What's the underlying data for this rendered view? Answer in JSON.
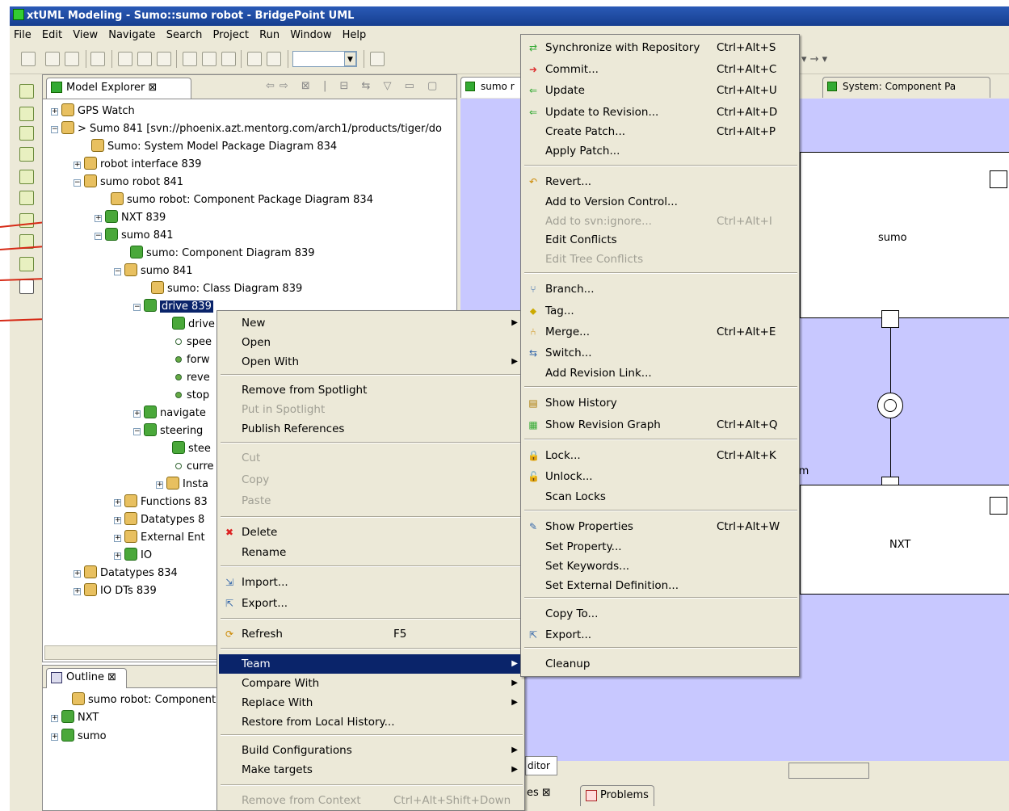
{
  "window": {
    "title": "xtUML Modeling - Sumo::sumo robot - BridgePoint UML"
  },
  "menubar": [
    "File",
    "Edit",
    "View",
    "Navigate",
    "Search",
    "Project",
    "Run",
    "Window",
    "Help"
  ],
  "explorer": {
    "tab_label": "Model Explorer",
    "close_glyph": "⊠",
    "tree": [
      {
        "label": "GPS Watch"
      },
      {
        "label": "> Sumo 841 [svn://phoenix.azt.mentorg.com/arch1/products/tiger/do"
      },
      {
        "label": "Sumo: System Model Package Diagram 834"
      },
      {
        "label": "robot interface 839"
      },
      {
        "label": "sumo robot 841"
      },
      {
        "label": "sumo robot: Component Package Diagram 834"
      },
      {
        "label": "NXT 839"
      },
      {
        "label": "sumo 841"
      },
      {
        "label": "sumo: Component Diagram 839"
      },
      {
        "label": "sumo 841"
      },
      {
        "label": "sumo: Class Diagram 839"
      },
      {
        "label": "drive 839"
      },
      {
        "label": "drive"
      },
      {
        "label": "spee"
      },
      {
        "label": "forw"
      },
      {
        "label": "reve"
      },
      {
        "label": "stop"
      },
      {
        "label": "navigate"
      },
      {
        "label": "steering"
      },
      {
        "label": "stee"
      },
      {
        "label": "curre"
      },
      {
        "label": "Insta"
      },
      {
        "label": "Functions 83"
      },
      {
        "label": "Datatypes 8"
      },
      {
        "label": "External Ent"
      },
      {
        "label": "IO"
      },
      {
        "label": "Datatypes 834"
      },
      {
        "label": "IO DTs 839"
      }
    ]
  },
  "outline": {
    "tab_label": "Outline",
    "items": [
      {
        "label": "sumo robot: Component"
      },
      {
        "label": "NXT"
      },
      {
        "label": "sumo"
      }
    ]
  },
  "editor": {
    "tabs": [
      {
        "label": "sumo r"
      },
      {
        "label": "System: Component Pa"
      }
    ],
    "components": {
      "sumo": "sumo",
      "platform": "platform",
      "nxt": "NXT"
    },
    "bottom_tabs": [
      {
        "label": "es"
      },
      {
        "label": "Problems"
      }
    ],
    "editor_tab_label": "ditor"
  },
  "context_menu": {
    "items": [
      {
        "label": "New",
        "submenu": true
      },
      {
        "label": "Open"
      },
      {
        "label": "Open With",
        "submenu": true
      },
      {
        "label": "Remove from Spotlight"
      },
      {
        "label": "Put in Spotlight",
        "disabled": true
      },
      {
        "label": "Publish References"
      },
      {
        "label": "Cut",
        "disabled": true
      },
      {
        "label": "Copy",
        "disabled": true
      },
      {
        "label": "Paste",
        "disabled": true
      },
      {
        "label": "Delete",
        "icon": "delete-icon"
      },
      {
        "label": "Rename"
      },
      {
        "label": "Import...",
        "icon": "import-icon"
      },
      {
        "label": "Export...",
        "icon": "export-icon"
      },
      {
        "label": "Refresh",
        "shortcut": "F5",
        "icon": "refresh-icon"
      },
      {
        "label": "Team",
        "submenu": true,
        "highlighted": true
      },
      {
        "label": "Compare With",
        "submenu": true
      },
      {
        "label": "Replace With",
        "submenu": true
      },
      {
        "label": "Restore from Local History..."
      },
      {
        "label": "Build Configurations",
        "submenu": true
      },
      {
        "label": "Make targets",
        "submenu": true
      },
      {
        "label": "Remove from Context",
        "shortcut": "Ctrl+Alt+Shift+Down",
        "disabled": true
      }
    ]
  },
  "team_menu": {
    "items": [
      {
        "label": "Synchronize with Repository",
        "shortcut": "Ctrl+Alt+S"
      },
      {
        "label": "Commit...",
        "shortcut": "Ctrl+Alt+C"
      },
      {
        "label": "Update",
        "shortcut": "Ctrl+Alt+U"
      },
      {
        "label": "Update to Revision...",
        "shortcut": "Ctrl+Alt+D"
      },
      {
        "label": "Create Patch...",
        "shortcut": "Ctrl+Alt+P"
      },
      {
        "label": "Apply Patch..."
      },
      {
        "label": "Revert..."
      },
      {
        "label": "Add to Version Control..."
      },
      {
        "label": "Add to svn:ignore...",
        "shortcut": "Ctrl+Alt+I",
        "disabled": true
      },
      {
        "label": "Edit Conflicts"
      },
      {
        "label": "Edit Tree Conflicts",
        "disabled": true
      },
      {
        "label": "Branch..."
      },
      {
        "label": "Tag..."
      },
      {
        "label": "Merge...",
        "shortcut": "Ctrl+Alt+E"
      },
      {
        "label": "Switch..."
      },
      {
        "label": "Add Revision Link..."
      },
      {
        "label": "Show History"
      },
      {
        "label": "Show Revision Graph",
        "shortcut": "Ctrl+Alt+Q"
      },
      {
        "label": "Lock...",
        "shortcut": "Ctrl+Alt+K"
      },
      {
        "label": "Unlock..."
      },
      {
        "label": "Scan Locks"
      },
      {
        "label": "Show Properties",
        "shortcut": "Ctrl+Alt+W"
      },
      {
        "label": "Set Property..."
      },
      {
        "label": "Set Keywords..."
      },
      {
        "label": "Set External Definition..."
      },
      {
        "label": "Copy To..."
      },
      {
        "label": "Export..."
      },
      {
        "label": "Cleanup"
      }
    ]
  },
  "colors": {
    "selection": "#0a246a",
    "canvas": "#c8c8ff",
    "arrow": "#d62a16",
    "chrome": "#ece9d8"
  }
}
